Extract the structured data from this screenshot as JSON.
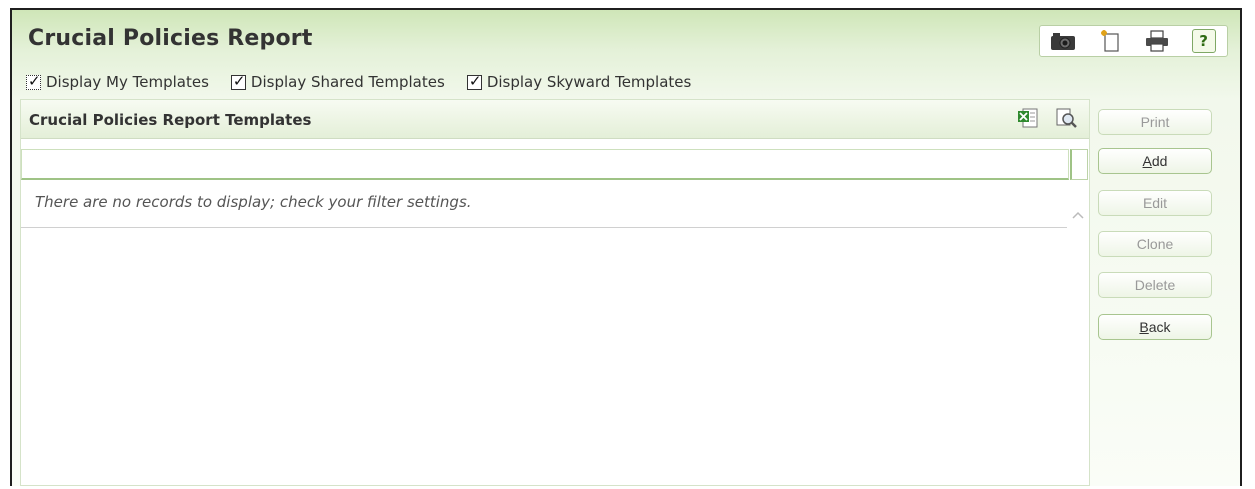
{
  "page": {
    "title": "Crucial Policies Report"
  },
  "toolbar": {
    "icons": [
      "camera-icon",
      "new-tab-icon",
      "printer-icon",
      "help-icon"
    ],
    "help_label": "?"
  },
  "filters": {
    "my_templates": {
      "label": "Display My Templates",
      "checked": true
    },
    "shared_templates": {
      "label": "Display Shared Templates",
      "checked": true
    },
    "skyward_templates": {
      "label": "Display Skyward Templates",
      "checked": true
    }
  },
  "panel": {
    "title": "Crucial Policies Report Templates",
    "icons": [
      "excel-export-icon",
      "print-preview-icon"
    ],
    "empty_message": "There are no records to display; check your filter settings."
  },
  "actions": {
    "print": {
      "label": "Print",
      "enabled": false
    },
    "add": {
      "underline": "A",
      "rest": "dd",
      "enabled": true
    },
    "edit": {
      "label": "Edit",
      "enabled": false
    },
    "clone": {
      "label": "Clone",
      "enabled": false
    },
    "delete": {
      "label": "Delete",
      "enabled": false
    },
    "back": {
      "underline": "B",
      "rest": "ack",
      "enabled": true
    }
  },
  "colors": {
    "accent_green": "#9fc386",
    "header_gradient_top": "#cfe6b8",
    "help_green": "#2e6b12"
  }
}
